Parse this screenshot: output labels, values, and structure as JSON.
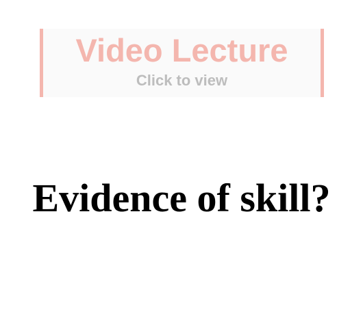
{
  "video_banner": {
    "title": "Video Lecture",
    "subtitle": "Click to view",
    "accent_color": "#f4b6ae",
    "subtitle_color": "#bdbdbd",
    "background_color": "#fafafa"
  },
  "heading": {
    "text": "Evidence of skill?"
  }
}
